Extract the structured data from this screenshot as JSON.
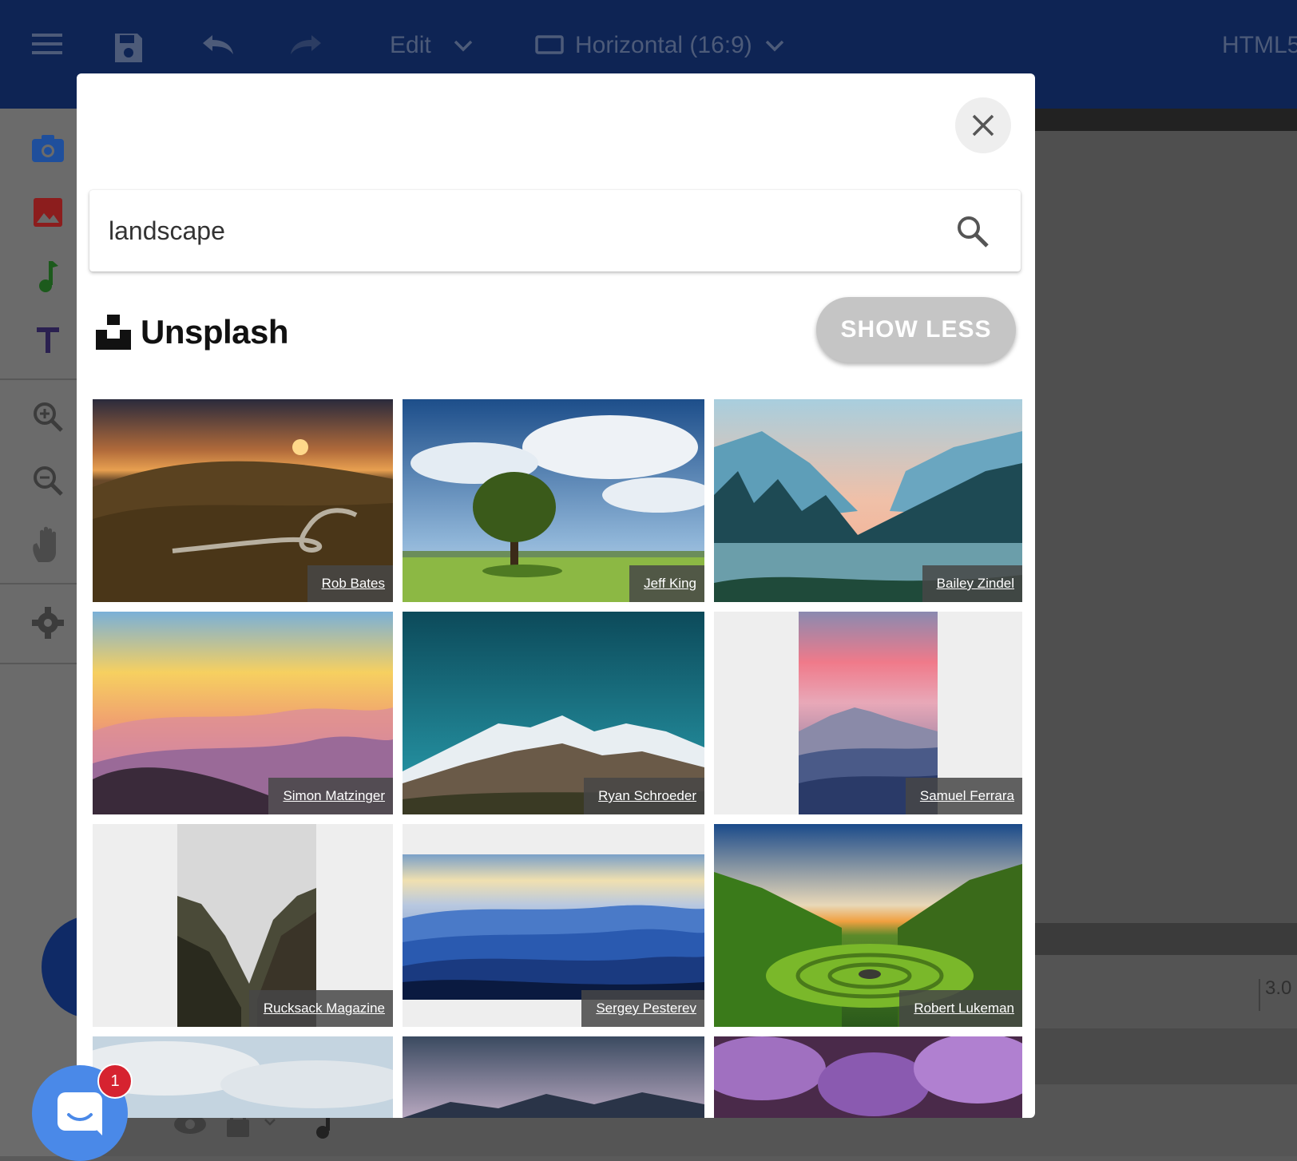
{
  "toolbar": {
    "menu_icon": "hamburger-menu-icon",
    "save_icon": "save-icon",
    "undo_icon": "undo-icon",
    "redo_icon": "redo-icon",
    "edit_label": "Edit",
    "aspect_label": "Horizontal (16:9)",
    "export_label": "HTML5"
  },
  "sidebar": {
    "tools": [
      "camera-icon",
      "image-icon",
      "music-note-icon",
      "text-icon",
      "zoom-in-icon",
      "zoom-out-icon",
      "hand-icon",
      "settings-icon"
    ],
    "colors": {
      "camera": "#1f4f9c",
      "image": "#8c1d1d",
      "music": "#1c5a1c",
      "text": "#2a2050"
    }
  },
  "timeline": {
    "marker": "3.0"
  },
  "modal": {
    "search": {
      "value": "landscape",
      "placeholder": ""
    },
    "source_name": "Unsplash",
    "show_less_label": "SHOW LESS",
    "photos": [
      {
        "credit": "Rob Bates",
        "subject": "winding road in hills at sunset"
      },
      {
        "credit": "Jeff King",
        "subject": "lone tree under blue sky"
      },
      {
        "credit": "Bailey Zindel",
        "subject": "valley with river and cliffs"
      },
      {
        "credit": "Simon Matzinger",
        "subject": "pastel mountain sunrise"
      },
      {
        "credit": "Ryan Schroeder",
        "subject": "snowy mountain ridge"
      },
      {
        "credit": "Samuel Ferrara",
        "subject": "mountain peak at pink dusk"
      },
      {
        "credit": "Rucksack Magazine",
        "subject": "mountain valley"
      },
      {
        "credit": "Sergey Pesterev",
        "subject": "blue layered mountains"
      },
      {
        "credit": "Robert Lukeman",
        "subject": "green spiral valley"
      },
      {
        "credit": "",
        "subject": "cloudy sky"
      },
      {
        "credit": "",
        "subject": "stormy mountains"
      },
      {
        "credit": "",
        "subject": "purple flowering trees"
      }
    ]
  },
  "launcher": {
    "badge_count": "1",
    "icon": "chat-icon"
  },
  "colors": {
    "accent": "#0e2454",
    "modal_bg": "#ffffff",
    "button_grey": "#c5c5c5",
    "badge": "#d62330",
    "launcher": "#4a89e8"
  }
}
